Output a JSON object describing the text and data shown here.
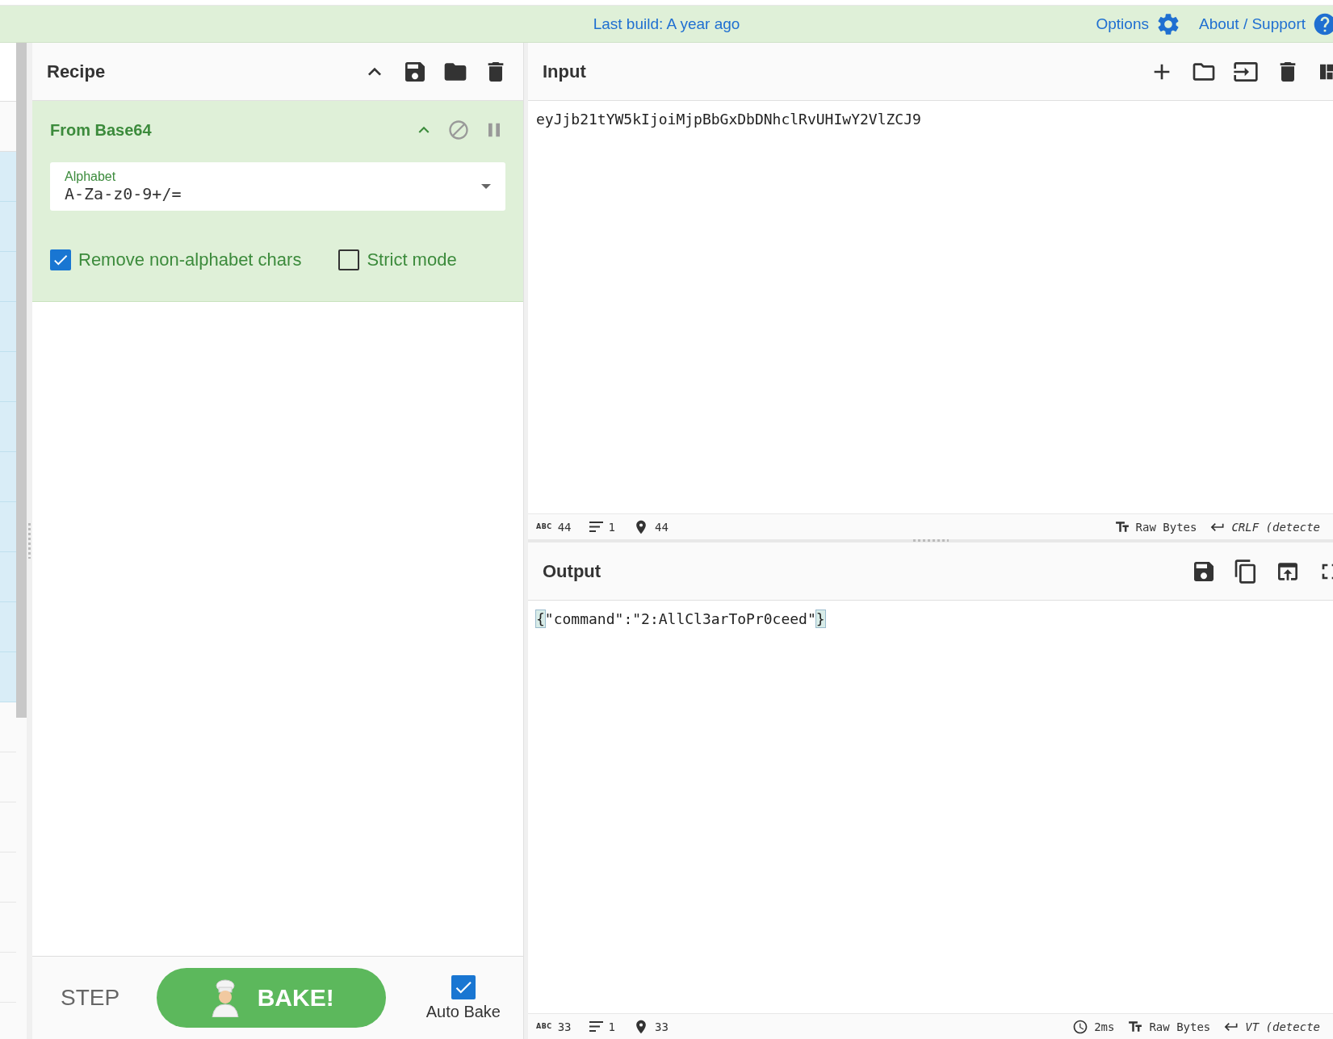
{
  "top_bar": {
    "build": "Last build: A year ago",
    "links": [
      {
        "label": "Options",
        "kind": "options"
      },
      {
        "label": "About / Support",
        "kind": "help"
      }
    ]
  },
  "recipe": {
    "title": "Recipe",
    "operations": [
      {
        "name": "From Base64",
        "args": [
          {
            "kind": "dropdown",
            "label": "Alphabet",
            "value": "A-Za-z0-9+/="
          },
          {
            "kind": "checkbox",
            "label": "Remove non-alphabet chars",
            "checked": true
          },
          {
            "kind": "checkbox",
            "label": "Strict mode",
            "checked": false
          }
        ]
      }
    ]
  },
  "controls": {
    "step": "STEP",
    "bake": "BAKE!",
    "auto_bake": {
      "label": "Auto Bake",
      "checked": true
    }
  },
  "input": {
    "title": "Input",
    "value": "eyJjb21tYW5kIjoiMjpBbGxDbDNhclRvUHIwY2VlZCJ9",
    "status": [
      {
        "kind": "length",
        "badge": "ABC",
        "text": "44"
      },
      {
        "kind": "lines",
        "text": "1"
      },
      {
        "kind": "position",
        "text": "44"
      },
      {
        "kind": "encoding",
        "text": "Raw Bytes"
      },
      {
        "kind": "eol",
        "text": "CRLF (detecte"
      }
    ]
  },
  "output": {
    "title": "Output",
    "value": "{\"command\":\"2:AllCl3arToPr0ceed\"}",
    "bracket_match": true,
    "status": [
      {
        "kind": "length",
        "badge": "ABC",
        "text": "33"
      },
      {
        "kind": "lines",
        "text": "1"
      },
      {
        "kind": "position",
        "text": "33"
      },
      {
        "kind": "time",
        "text": "2ms"
      },
      {
        "kind": "encoding",
        "text": "Raw Bytes"
      },
      {
        "kind": "eol",
        "text": "VT (detecte"
      }
    ]
  }
}
